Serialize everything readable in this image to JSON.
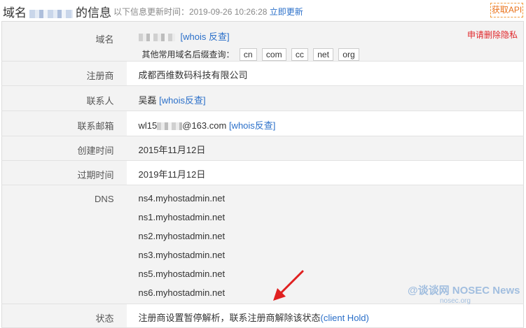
{
  "header": {
    "title_prefix": "域名",
    "title_suffix": "的信息",
    "update_info": "以下信息更新时间：2019-09-26 10:26:28",
    "update_link": "立即更新",
    "api_button": "获取API"
  },
  "domain_row": {
    "label": "域名",
    "whois_link": "[whois 反查]",
    "privacy_link": "申请删除隐私",
    "other_tlds_label": "其他常用域名后缀查询：",
    "tlds": [
      "cn",
      "com",
      "cc",
      "net",
      "org"
    ]
  },
  "registrar_row": {
    "label": "注册商",
    "value": "成都西维数码科技有限公司"
  },
  "contact_row": {
    "label": "联系人",
    "value": "吴磊",
    "whois_link": "[whois反查]"
  },
  "email_row": {
    "label": "联系邮箱",
    "value_prefix": "wl15",
    "value_suffix": "@163.com",
    "whois_link": "[whois反查]"
  },
  "created_row": {
    "label": "创建时间",
    "value": "2015年11月12日"
  },
  "expire_row": {
    "label": "过期时间",
    "value": "2019年11月12日"
  },
  "dns_row": {
    "label": "DNS",
    "servers": [
      "ns4.myhostadmin.net",
      "ns1.myhostadmin.net",
      "ns2.myhostadmin.net",
      "ns3.myhostadmin.net",
      "ns5.myhostadmin.net",
      "ns6.myhostadmin.net"
    ]
  },
  "status_row": {
    "label": "状态",
    "value": "注册商设置暂停解析，联系注册商解除该状态",
    "code_link": "(client Hold)"
  },
  "watermark": {
    "main": "@谈谈网 NOSEC News",
    "sub": "nosec.org"
  },
  "colors": {
    "link": "#2a6fc9",
    "privacy": "#e0272b",
    "api_border": "#f29a3c",
    "arrow": "#e02020"
  }
}
